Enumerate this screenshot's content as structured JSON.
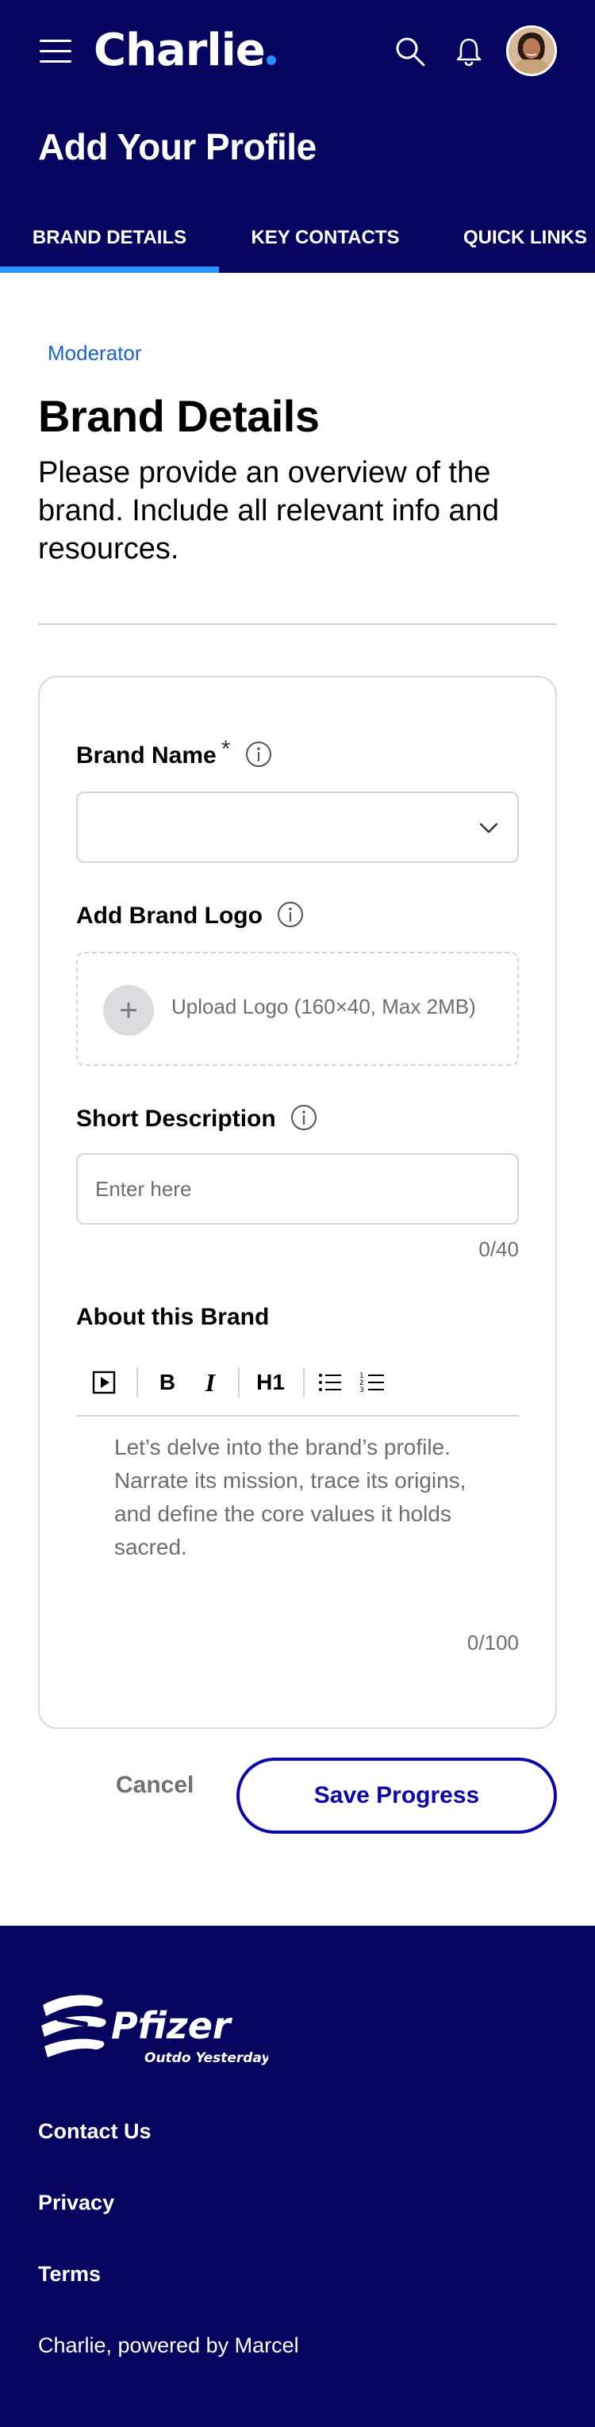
{
  "header": {
    "app_name": "Charlie",
    "page_title": "Add Your Profile",
    "tabs": [
      {
        "label": "BRAND DETAILS",
        "active": true
      },
      {
        "label": "KEY CONTACTS",
        "active": false
      },
      {
        "label": "QUICK LINKS",
        "active": false
      }
    ],
    "icons": [
      "menu-icon",
      "search-icon",
      "bell-icon"
    ],
    "colors": {
      "header_bg": "#05045e",
      "tab_indicator": "#2a93ff"
    }
  },
  "intro": {
    "role": "Moderator",
    "title": "Brand Details",
    "description": "Please provide an overview of the brand. Include all relevant info and resources."
  },
  "form": {
    "brand_name": {
      "label": "Brand Name",
      "required_mark": "*",
      "value": ""
    },
    "logo": {
      "label": "Add Brand Logo",
      "upload_text": "Upload Logo (160×40, Max 2MB)"
    },
    "short_description": {
      "label": "Short Description",
      "placeholder": "Enter here",
      "value": "",
      "counter": "0/40"
    },
    "about": {
      "label": "About this Brand",
      "toolbar": [
        "video-icon",
        "B",
        "I",
        "H1",
        "bullet-list-icon",
        "numbered-list-icon"
      ],
      "placeholder": "Let’s delve into the brand’s profile. Narrate its mission, trace its origins, and define the core values it holds sacred.",
      "counter": "0/100"
    }
  },
  "actions": {
    "cancel": "Cancel",
    "save": "Save Progress",
    "save_color": "#0b07a8"
  },
  "footer": {
    "brand_logo_text": "Pfizer",
    "brand_logo_tagline": "Outdo Yesterday",
    "links": [
      "Contact Us",
      "Privacy",
      "Terms"
    ],
    "powered_by": "Charlie, powered by Marcel"
  }
}
